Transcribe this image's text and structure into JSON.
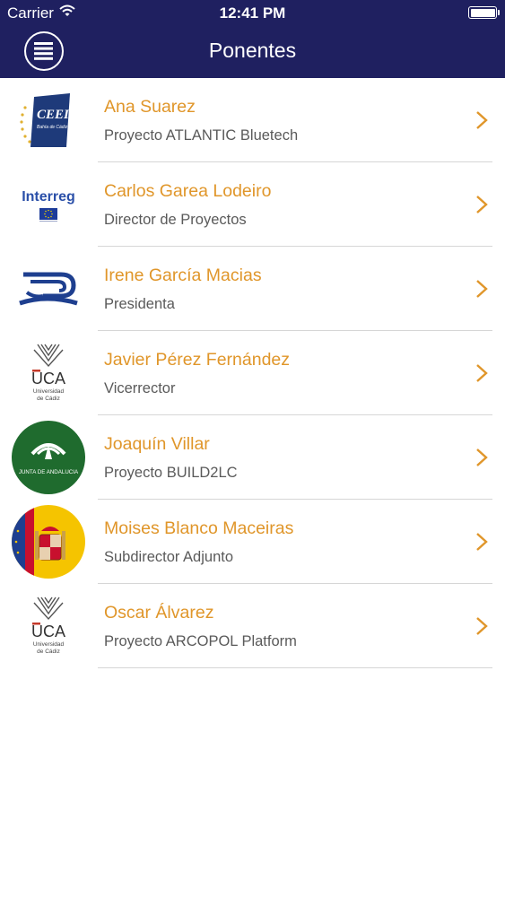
{
  "status_bar": {
    "carrier": "Carrier",
    "time": "12:41 PM",
    "wifi_icon": "wifi-icon",
    "battery_icon": "battery-icon"
  },
  "nav": {
    "title": "Ponentes",
    "menu_icon": "menu-icon"
  },
  "colors": {
    "header_bg": "#1f2060",
    "name_text": "#e0962a",
    "subtitle_text": "#5a5a5a",
    "separator": "#d6d6d6"
  },
  "speakers": [
    {
      "name": "Ana Suarez",
      "subtitle": "Proyecto ATLANTIC Bluetech",
      "logo": "ceei-logo",
      "logo_text": "CEEI",
      "logo_subtext": "Bahía de Cádiz"
    },
    {
      "name": "Carlos Garea Lodeiro",
      "subtitle": "Director de Proyectos",
      "logo": "interreg-logo",
      "logo_text": "Interreg"
    },
    {
      "name": "Irene García Macias",
      "subtitle": "Presidenta",
      "logo": "wave-logo"
    },
    {
      "name": "Javier Pérez Fernández",
      "subtitle": "Vicerrector",
      "logo": "uca-logo",
      "logo_text": "UCA",
      "logo_subtext": "Universidad",
      "logo_subtext2": "de Cádiz"
    },
    {
      "name": "Joaquín Villar",
      "subtitle": "Proyecto BUILD2LC",
      "logo": "junta-andalucia-logo",
      "logo_text": "JUNTA DE ANDALUCIA"
    },
    {
      "name": "Moises Blanco Maceiras",
      "subtitle": "Subdirector Adjunto",
      "logo": "spain-coat-of-arms-logo"
    },
    {
      "name": "Oscar Álvarez",
      "subtitle": "Proyecto ARCOPOL Platform",
      "logo": "uca-logo",
      "logo_text": "UCA",
      "logo_subtext": "Universidad",
      "logo_subtext2": "de Cádiz"
    }
  ]
}
